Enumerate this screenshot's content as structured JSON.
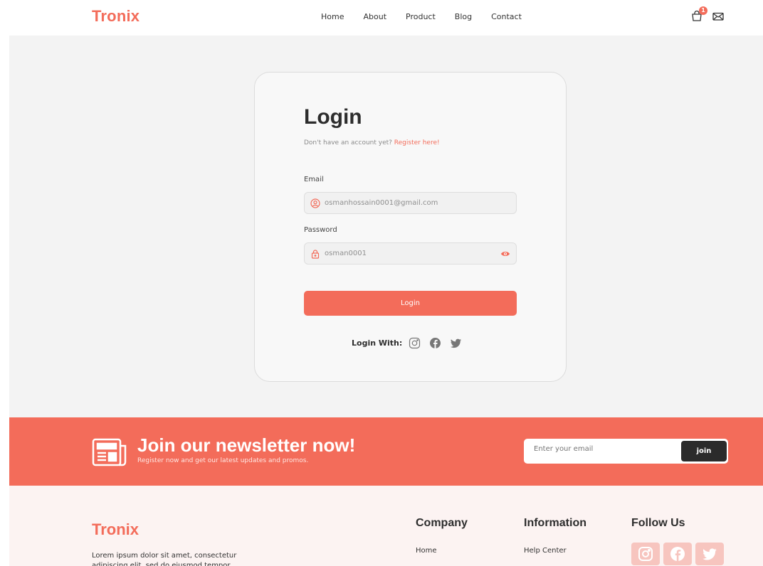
{
  "header": {
    "logo": "Tronix",
    "nav": [
      "Home",
      "About",
      "Product",
      "Blog",
      "Contact"
    ],
    "cart_count": "1"
  },
  "login": {
    "title": "Login",
    "no_account": "Don't have an account yet?",
    "register_link": "Register here!",
    "email_label": "Email",
    "email_value": "osmanhossain0001@gmail.com",
    "password_label": "Password",
    "password_value": "osman0001",
    "button": "Login",
    "login_with": "Login With:"
  },
  "newsletter": {
    "title": "Join our newsletter now!",
    "subtitle": "Register now and get our latest updates and promos.",
    "placeholder": "Enter your email",
    "button": "join"
  },
  "footer": {
    "logo": "Tronix",
    "description": "Lorem ipsum dolor sit amet, consectetur adipiscing elit, sed do eiusmod tempor",
    "columns": [
      {
        "title": "Company",
        "first_link": "Home"
      },
      {
        "title": "Information",
        "first_link": "Help Center"
      },
      {
        "title": "Follow Us"
      }
    ]
  },
  "colors": {
    "accent": "#f36c5a",
    "dark": "#2b2b2b"
  },
  "icons": {
    "header": [
      "cart-icon",
      "mail-icon"
    ],
    "login_social": [
      "instagram-icon",
      "facebook-icon",
      "twitter-icon"
    ],
    "footer_social": [
      "instagram-icon",
      "facebook-icon",
      "twitter-icon"
    ]
  }
}
